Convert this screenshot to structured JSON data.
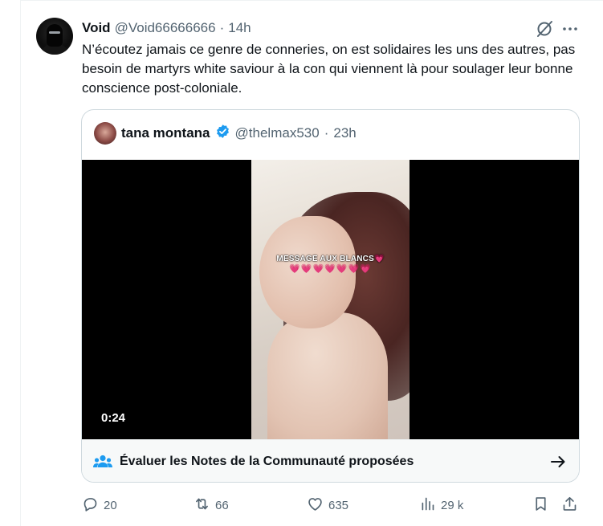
{
  "tweet": {
    "author_name": "Void",
    "author_handle": "@Void66666666",
    "separator": "·",
    "time": "14h",
    "text": "N’écoutez jamais ce genre de conneries, on est solidaires les uns des autres, pas besoin de martyrs white saviour à la con qui viennent là pour soulager leur bonne conscience post-coloniale."
  },
  "quote": {
    "author_name": "tana montana",
    "author_handle": "@thelmax530",
    "separator": "·",
    "time": "23h",
    "video": {
      "overlay_text": "MESSAGE AUX BLANCS💗",
      "overlay_hearts": "💗💗💗💗💗💗💗",
      "duration": "0:24"
    },
    "community_notes": {
      "label": "Évaluer les Notes de la Communauté proposées"
    }
  },
  "actions": {
    "replies": "20",
    "retweets": "66",
    "likes": "635",
    "views": "29 k"
  },
  "icons": {
    "grok": "grok-icon",
    "more": "more-icon",
    "verified": "verified-badge-icon",
    "community": "people-icon",
    "arrow": "arrow-right-icon",
    "reply": "reply-icon",
    "retweet": "retweet-icon",
    "like": "heart-icon",
    "views": "views-icon",
    "bookmark": "bookmark-icon",
    "share": "share-icon"
  },
  "colors": {
    "verified": "#1d9bf0",
    "text": "#0f1419",
    "muted": "#536471",
    "border": "#cfd9de",
    "notes_bg": "#f7f9f9"
  }
}
